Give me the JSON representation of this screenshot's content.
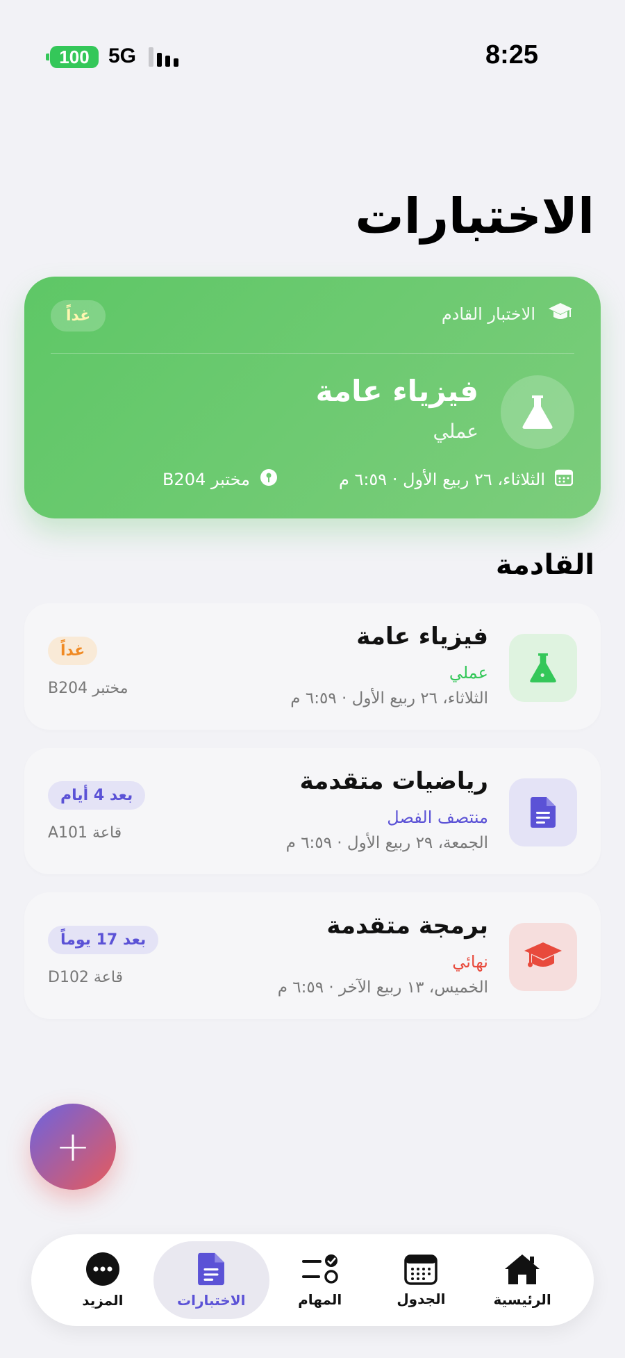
{
  "status_bar": {
    "time": "8:25",
    "network": "5G",
    "battery": "100"
  },
  "page": {
    "title": "الاختبارات"
  },
  "hero": {
    "header": "الاختبار القادم",
    "badge": "غداً",
    "subject": "فيزياء عامة",
    "type": "عملي",
    "datetime": "الثلاثاء، ٢٦ ربيع الأول · ٦:٥٩ م",
    "location": "مختبر B204"
  },
  "section": {
    "title": "القادمة"
  },
  "exams": [
    {
      "subject": "فيزياء عامة",
      "type": "عملي",
      "datetime": "الثلاثاء، ٢٦ ربيع الأول · ٦:٥٩ م",
      "badge": "غداً",
      "room": "مختبر B204",
      "icon": "flask-icon",
      "type_color": "#34c759",
      "icon_bg": "#dff3e0",
      "badge_bg": "#f9ead7",
      "badge_color": "#f08a24"
    },
    {
      "subject": "رياضيات متقدمة",
      "type": "منتصف الفصل",
      "datetime": "الجمعة، ٢٩ ربيع الأول · ٦:٥٩ م",
      "badge": "بعد 4 أيام",
      "room": "قاعة A101",
      "icon": "document-icon",
      "type_color": "#5b52d6",
      "icon_bg": "#e4e3f6",
      "badge_bg": "#e4e3f6",
      "badge_color": "#5b52d6"
    },
    {
      "subject": "برمجة متقدمة",
      "type": "نهائي",
      "datetime": "الخميس، ١٣ ربيع الآخر · ٦:٥٩ م",
      "badge": "بعد 17 يوماً",
      "room": "قاعة D102",
      "icon": "graduation-cap-icon",
      "type_color": "#e84a3c",
      "icon_bg": "#f6dedd",
      "badge_bg": "#e4e3f6",
      "badge_color": "#5b52d6"
    }
  ],
  "fab": {
    "label": "+"
  },
  "tabs": [
    {
      "label": "الرئيسية",
      "icon": "home-icon"
    },
    {
      "label": "الجدول",
      "icon": "calendar-icon"
    },
    {
      "label": "المهام",
      "icon": "tasks-icon"
    },
    {
      "label": "الاختبارات",
      "icon": "document-icon",
      "active": true
    },
    {
      "label": "المزيد",
      "icon": "more-icon"
    }
  ],
  "colors": {
    "accent": "#5b52d6",
    "hero_green": "#5ec766",
    "background": "#f2f2f6"
  }
}
